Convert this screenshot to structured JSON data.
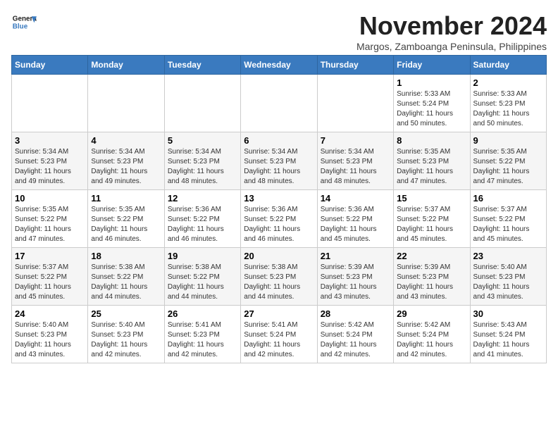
{
  "logo": {
    "line1": "General",
    "line2": "Blue"
  },
  "title": "November 2024",
  "subtitle": "Margos, Zamboanga Peninsula, Philippines",
  "weekdays": [
    "Sunday",
    "Monday",
    "Tuesday",
    "Wednesday",
    "Thursday",
    "Friday",
    "Saturday"
  ],
  "weeks": [
    [
      {
        "day": "",
        "info": ""
      },
      {
        "day": "",
        "info": ""
      },
      {
        "day": "",
        "info": ""
      },
      {
        "day": "",
        "info": ""
      },
      {
        "day": "",
        "info": ""
      },
      {
        "day": "1",
        "info": "Sunrise: 5:33 AM\nSunset: 5:24 PM\nDaylight: 11 hours\nand 50 minutes."
      },
      {
        "day": "2",
        "info": "Sunrise: 5:33 AM\nSunset: 5:23 PM\nDaylight: 11 hours\nand 50 minutes."
      }
    ],
    [
      {
        "day": "3",
        "info": "Sunrise: 5:34 AM\nSunset: 5:23 PM\nDaylight: 11 hours\nand 49 minutes."
      },
      {
        "day": "4",
        "info": "Sunrise: 5:34 AM\nSunset: 5:23 PM\nDaylight: 11 hours\nand 49 minutes."
      },
      {
        "day": "5",
        "info": "Sunrise: 5:34 AM\nSunset: 5:23 PM\nDaylight: 11 hours\nand 48 minutes."
      },
      {
        "day": "6",
        "info": "Sunrise: 5:34 AM\nSunset: 5:23 PM\nDaylight: 11 hours\nand 48 minutes."
      },
      {
        "day": "7",
        "info": "Sunrise: 5:34 AM\nSunset: 5:23 PM\nDaylight: 11 hours\nand 48 minutes."
      },
      {
        "day": "8",
        "info": "Sunrise: 5:35 AM\nSunset: 5:23 PM\nDaylight: 11 hours\nand 47 minutes."
      },
      {
        "day": "9",
        "info": "Sunrise: 5:35 AM\nSunset: 5:22 PM\nDaylight: 11 hours\nand 47 minutes."
      }
    ],
    [
      {
        "day": "10",
        "info": "Sunrise: 5:35 AM\nSunset: 5:22 PM\nDaylight: 11 hours\nand 47 minutes."
      },
      {
        "day": "11",
        "info": "Sunrise: 5:35 AM\nSunset: 5:22 PM\nDaylight: 11 hours\nand 46 minutes."
      },
      {
        "day": "12",
        "info": "Sunrise: 5:36 AM\nSunset: 5:22 PM\nDaylight: 11 hours\nand 46 minutes."
      },
      {
        "day": "13",
        "info": "Sunrise: 5:36 AM\nSunset: 5:22 PM\nDaylight: 11 hours\nand 46 minutes."
      },
      {
        "day": "14",
        "info": "Sunrise: 5:36 AM\nSunset: 5:22 PM\nDaylight: 11 hours\nand 45 minutes."
      },
      {
        "day": "15",
        "info": "Sunrise: 5:37 AM\nSunset: 5:22 PM\nDaylight: 11 hours\nand 45 minutes."
      },
      {
        "day": "16",
        "info": "Sunrise: 5:37 AM\nSunset: 5:22 PM\nDaylight: 11 hours\nand 45 minutes."
      }
    ],
    [
      {
        "day": "17",
        "info": "Sunrise: 5:37 AM\nSunset: 5:22 PM\nDaylight: 11 hours\nand 45 minutes."
      },
      {
        "day": "18",
        "info": "Sunrise: 5:38 AM\nSunset: 5:22 PM\nDaylight: 11 hours\nand 44 minutes."
      },
      {
        "day": "19",
        "info": "Sunrise: 5:38 AM\nSunset: 5:22 PM\nDaylight: 11 hours\nand 44 minutes."
      },
      {
        "day": "20",
        "info": "Sunrise: 5:38 AM\nSunset: 5:23 PM\nDaylight: 11 hours\nand 44 minutes."
      },
      {
        "day": "21",
        "info": "Sunrise: 5:39 AM\nSunset: 5:23 PM\nDaylight: 11 hours\nand 43 minutes."
      },
      {
        "day": "22",
        "info": "Sunrise: 5:39 AM\nSunset: 5:23 PM\nDaylight: 11 hours\nand 43 minutes."
      },
      {
        "day": "23",
        "info": "Sunrise: 5:40 AM\nSunset: 5:23 PM\nDaylight: 11 hours\nand 43 minutes."
      }
    ],
    [
      {
        "day": "24",
        "info": "Sunrise: 5:40 AM\nSunset: 5:23 PM\nDaylight: 11 hours\nand 43 minutes."
      },
      {
        "day": "25",
        "info": "Sunrise: 5:40 AM\nSunset: 5:23 PM\nDaylight: 11 hours\nand 42 minutes."
      },
      {
        "day": "26",
        "info": "Sunrise: 5:41 AM\nSunset: 5:23 PM\nDaylight: 11 hours\nand 42 minutes."
      },
      {
        "day": "27",
        "info": "Sunrise: 5:41 AM\nSunset: 5:24 PM\nDaylight: 11 hours\nand 42 minutes."
      },
      {
        "day": "28",
        "info": "Sunrise: 5:42 AM\nSunset: 5:24 PM\nDaylight: 11 hours\nand 42 minutes."
      },
      {
        "day": "29",
        "info": "Sunrise: 5:42 AM\nSunset: 5:24 PM\nDaylight: 11 hours\nand 42 minutes."
      },
      {
        "day": "30",
        "info": "Sunrise: 5:43 AM\nSunset: 5:24 PM\nDaylight: 11 hours\nand 41 minutes."
      }
    ]
  ]
}
